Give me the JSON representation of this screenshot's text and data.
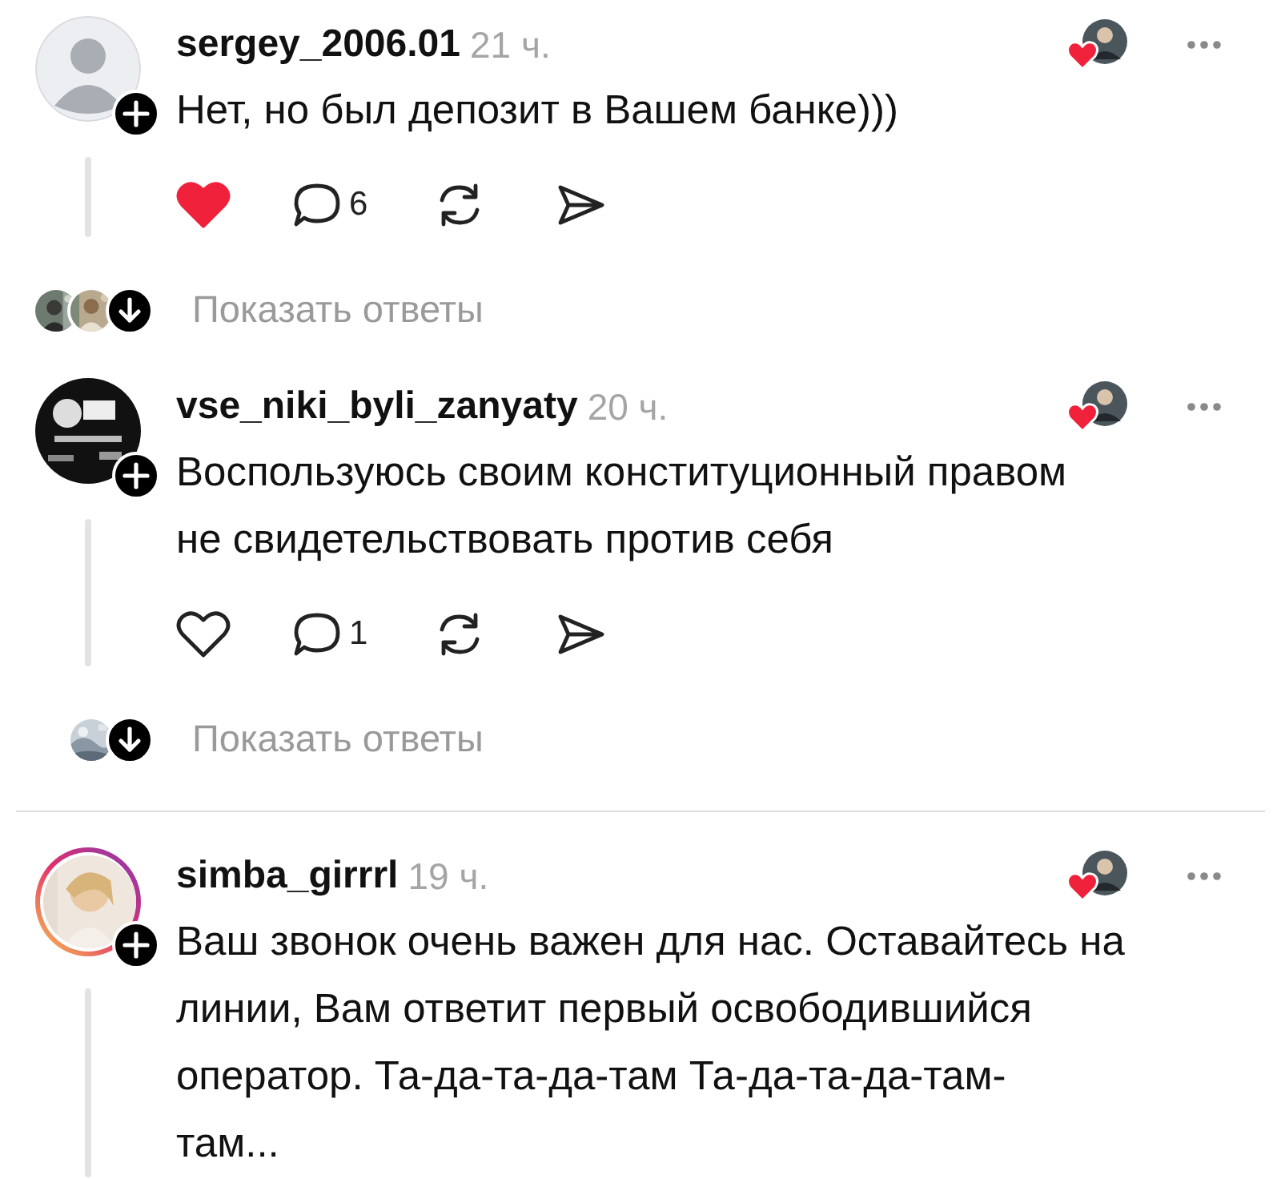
{
  "comments": [
    {
      "username": "sergey_2006.01",
      "time": "21 ч.",
      "avatar": {
        "kind": "placeholder"
      },
      "story_ring": false,
      "text": [
        "Нет, но был депозит в Вашем банке)))"
      ],
      "actions": {
        "liked": true,
        "reply_count": "6"
      },
      "replies": {
        "label": "Показать ответы",
        "avatars": [
          {
            "kind": "picture"
          },
          {
            "kind": "picture"
          }
        ]
      }
    },
    {
      "username": "vse_niki_byli_zanyaty",
      "time": "20 ч.",
      "avatar": {
        "kind": "picture"
      },
      "story_ring": false,
      "text": [
        "Воспользуюсь своим конституционный правом",
        "не свидетельствовать против себя"
      ],
      "actions": {
        "liked": false,
        "reply_count": "1"
      },
      "replies": {
        "label": "Показать ответы",
        "avatars": [
          {
            "kind": "picture"
          }
        ]
      }
    },
    {
      "username": "simba_girrrl",
      "time": "19 ч.",
      "avatar": {
        "kind": "picture"
      },
      "story_ring": true,
      "text": [
        "Ваш звонок очень важен для нас. Оставайтесь на",
        "линии, Вам ответит первый освободившийся",
        "оператор. Та-да-та-да-там Та-да-та-да-там-",
        "там..."
      ]
    }
  ]
}
